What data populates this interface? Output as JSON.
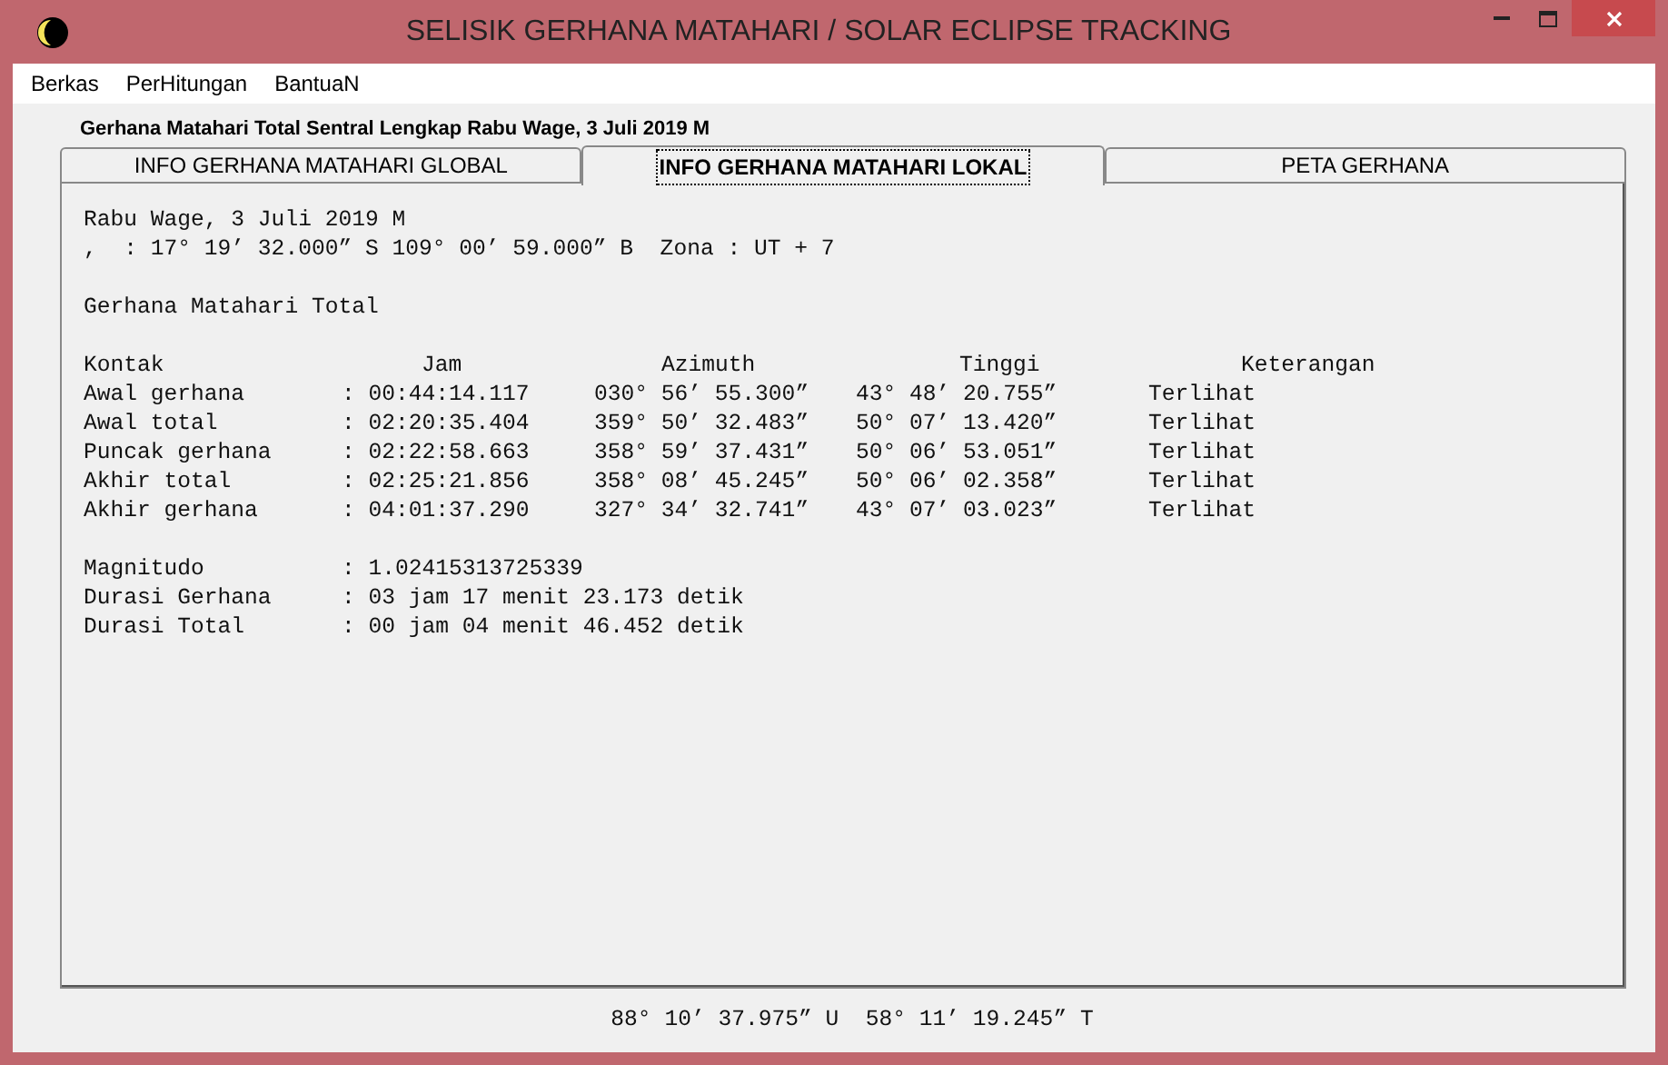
{
  "window": {
    "title": "SELISIK GERHANA MATAHARI / SOLAR ECLIPSE TRACKING"
  },
  "menu": [
    "Berkas",
    "PerHitungan",
    "BantuaN"
  ],
  "heading": "Gerhana Matahari Total Sentral Lengkap Rabu Wage, 3 Juli 2019 M",
  "tabs": [
    {
      "label": "INFO GERHANA MATAHARI GLOBAL",
      "selected": false
    },
    {
      "label": "INFO GERHANA MATAHARI LOKAL",
      "selected": true
    },
    {
      "label": "PETA GERHANA",
      "selected": false
    }
  ],
  "info_lines": [
    "Rabu Wage, 3 Juli 2019 M",
    ",  : 17° 19’ 32.000” S 109° 00’ 59.000” B  Zona : UT + 7"
  ],
  "eclipse_type": "Gerhana Matahari Total",
  "table": {
    "columns": [
      "Kontak",
      "Jam",
      "Azimuth",
      "Tinggi",
      "Keterangan"
    ],
    "rows": [
      [
        "Awal gerhana",
        ": 00:44:14.117",
        "030° 56’ 55.300”",
        "43° 48’ 20.755”",
        "Terlihat"
      ],
      [
        "Awal total",
        ": 02:20:35.404",
        "359° 50’ 32.483”",
        "50° 07’ 13.420”",
        "Terlihat"
      ],
      [
        "Puncak gerhana",
        ": 02:22:58.663",
        "358° 59’ 37.431”",
        "50° 06’ 53.051”",
        "Terlihat"
      ],
      [
        "Akhir total",
        ": 02:25:21.856",
        "358° 08’ 45.245”",
        "50° 06’ 02.358”",
        "Terlihat"
      ],
      [
        "Akhir gerhana",
        ": 04:01:37.290",
        "327° 34’ 32.741”",
        "43° 07’ 03.023”",
        "Terlihat"
      ]
    ]
  },
  "summary": [
    {
      "label": "Magnitudo",
      "value": ": 1.02415313725339"
    },
    {
      "label": "Durasi Gerhana",
      "value": ": 03 jam 17 menit 23.173 detik"
    },
    {
      "label": "Durasi Total",
      "value": ": 00 jam 04 menit 46.452 detik"
    }
  ],
  "status_bar": "88° 10’ 37.975” U  58° 11’ 19.245” T"
}
